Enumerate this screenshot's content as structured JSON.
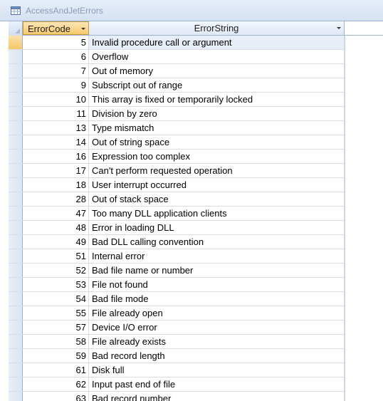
{
  "window": {
    "title": "AccessAndJetErrors",
    "icon": "table-icon"
  },
  "table": {
    "columns": [
      {
        "label": "ErrorCode",
        "sorted": true
      },
      {
        "label": "ErrorString",
        "sorted": false
      }
    ],
    "current_row": 0,
    "rows": [
      {
        "code": "5",
        "text": "Invalid procedure call or argument"
      },
      {
        "code": "6",
        "text": "Overflow"
      },
      {
        "code": "7",
        "text": "Out of memory"
      },
      {
        "code": "9",
        "text": "Subscript out of range"
      },
      {
        "code": "10",
        "text": "This array is fixed or temporarily locked"
      },
      {
        "code": "11",
        "text": "Division by zero"
      },
      {
        "code": "13",
        "text": "Type mismatch"
      },
      {
        "code": "14",
        "text": "Out of string space"
      },
      {
        "code": "16",
        "text": "Expression too complex"
      },
      {
        "code": "17",
        "text": "Can't perform requested operation"
      },
      {
        "code": "18",
        "text": "User interrupt occurred"
      },
      {
        "code": "28",
        "text": "Out of stack space"
      },
      {
        "code": "47",
        "text": "Too many DLL application clients"
      },
      {
        "code": "48",
        "text": "Error in loading DLL"
      },
      {
        "code": "49",
        "text": "Bad DLL calling convention"
      },
      {
        "code": "51",
        "text": "Internal error"
      },
      {
        "code": "52",
        "text": "Bad file name or number"
      },
      {
        "code": "53",
        "text": "File not found"
      },
      {
        "code": "54",
        "text": "Bad file mode"
      },
      {
        "code": "55",
        "text": "File already open"
      },
      {
        "code": "57",
        "text": "Device I/O error"
      },
      {
        "code": "58",
        "text": "File already exists"
      },
      {
        "code": "59",
        "text": "Bad record length"
      },
      {
        "code": "61",
        "text": "Disk full"
      },
      {
        "code": "62",
        "text": "Input past end of file"
      },
      {
        "code": "63",
        "text": "Bad record number"
      }
    ]
  }
}
